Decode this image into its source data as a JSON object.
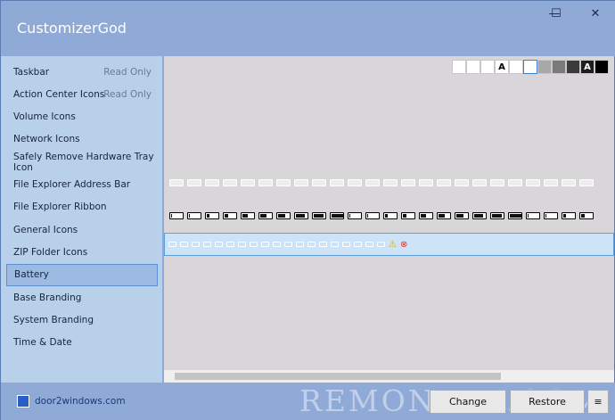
{
  "app": {
    "title": "CustomizerGod"
  },
  "window_controls": {
    "minimize": "—",
    "maximize": "☐",
    "close": "✕"
  },
  "sidebar": {
    "items": [
      {
        "label": "Taskbar",
        "note": "Read Only"
      },
      {
        "label": "Action Center Icons",
        "note": "Read Only"
      },
      {
        "label": "Volume Icons"
      },
      {
        "label": "Network Icons"
      },
      {
        "label": "Safely Remove Hardware Tray Icon"
      },
      {
        "label": "File Explorer Address Bar"
      },
      {
        "label": "File Explorer Ribbon"
      },
      {
        "label": "General Icons"
      },
      {
        "label": "ZIP Folder Icons"
      },
      {
        "label": "Battery",
        "active": true
      },
      {
        "label": "Base Branding"
      },
      {
        "label": "System Branding"
      },
      {
        "label": "Time & Date"
      }
    ]
  },
  "swatches": [
    {
      "bg": "#ffffff",
      "icon": "blank-swatch"
    },
    {
      "bg": "#ffffff",
      "icon": "half-swatch"
    },
    {
      "bg": "#ffffff",
      "icon": "checker-swatch"
    },
    {
      "bg": "#ffffff",
      "label": "A",
      "color": "#000000"
    },
    {
      "bg": "#ffffff",
      "icon": "blank-swatch"
    },
    {
      "bg": "#ffffff",
      "icon": "selected-swatch",
      "selected": true
    },
    {
      "bg": "#a8a8a8",
      "icon": "grey-swatch"
    },
    {
      "bg": "#7a7a7a",
      "icon": "dark-grey-swatch"
    },
    {
      "bg": "#3a3a3a",
      "icon": "checker-dark-swatch"
    },
    {
      "bg": "#1e1e1e",
      "label": "A",
      "color": "#ffffff"
    },
    {
      "bg": "#000000",
      "icon": "black-swatch"
    }
  ],
  "footer": {
    "brand": "door2windows.com",
    "change_label": "Change",
    "restore_label": "Restore",
    "menu_label": "≡",
    "watermark": "REMONTKA.COM"
  },
  "colors": {
    "accent": "#5d9fd8",
    "sidebar_bg": "#b9d0ea",
    "content_bg": "#d9d6da"
  }
}
